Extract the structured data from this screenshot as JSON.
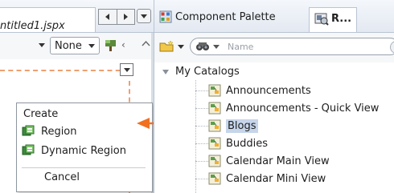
{
  "editor": {
    "tab_label": "ntitled1.jspx",
    "toolbar": {
      "none_select_value": "None"
    }
  },
  "popup": {
    "header": "Create",
    "items": [
      {
        "label": "Region",
        "icon": "region-icon"
      },
      {
        "label": "Dynamic Region",
        "icon": "dynamic-region-icon"
      }
    ],
    "cancel_label": "Cancel"
  },
  "callout": {
    "color": "#f07020"
  },
  "palette": {
    "tab_label": "Component Palette",
    "resource_tab_label": "R..."
  },
  "catalog": {
    "search": {
      "placeholder": "Name"
    },
    "root_label": "My Catalogs",
    "items": [
      {
        "label": "Announcements"
      },
      {
        "label": "Announcements - Quick View"
      },
      {
        "label": "Blogs",
        "selected": true
      },
      {
        "label": "Buddies"
      },
      {
        "label": "Calendar Main View"
      },
      {
        "label": "Calendar Mini View"
      }
    ]
  },
  "colors": {
    "selection": "#c6d5ea",
    "dashed_guide": "#f0a070"
  }
}
